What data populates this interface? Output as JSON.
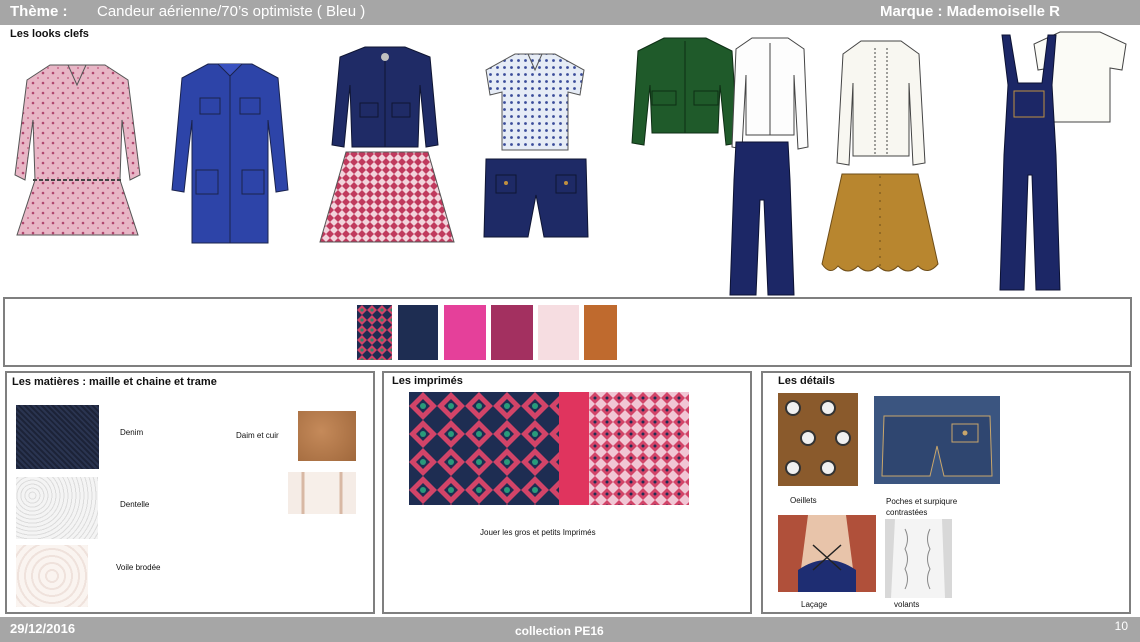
{
  "header": {
    "theme_label": "Thème :",
    "theme_value": "Candeur aérienne/70’s optimiste ( Bleu )",
    "brand": "Marque : Mademoiselle R"
  },
  "looks": {
    "title": "Les looks clefs"
  },
  "palette": {
    "colors": [
      "#7a1f3d",
      "#1e2d52",
      "#e5409a",
      "#a33060",
      "#f6dde1",
      "#bf6a2e"
    ]
  },
  "materials": {
    "title": "Les matières : maille et chaine et trame",
    "items": [
      "Denim",
      "Daim et cuir",
      "Dentelle",
      "Voile brodée"
    ]
  },
  "prints": {
    "title": "Les imprimés",
    "caption": "Jouer les gros et petits Imprimés"
  },
  "details": {
    "title": "Les détails",
    "items": [
      "Oeillets",
      "Poches et surpiqure contrastées",
      "Laçage",
      "volants"
    ]
  },
  "footer": {
    "date": "29/12/2016",
    "collection": "collection PE16",
    "page": "10"
  },
  "colors": {
    "bar": "#a6a6a6",
    "navy": "#1e2d5e",
    "royal": "#2b3f9e",
    "pink_print": "#e7b7c8",
    "green": "#1f5a2a",
    "camel": "#b8862f"
  }
}
